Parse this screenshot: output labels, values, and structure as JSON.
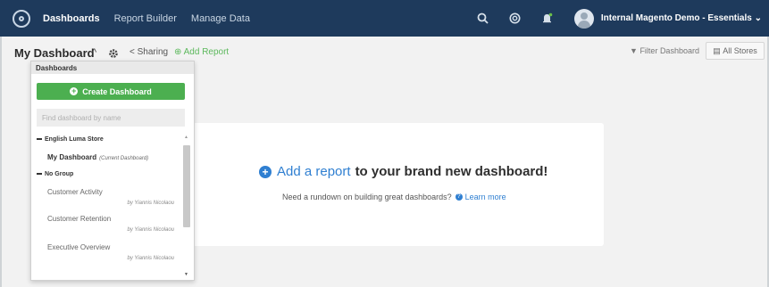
{
  "topnav": {
    "items": [
      {
        "label": "Dashboards"
      },
      {
        "label": "Report Builder"
      },
      {
        "label": "Manage Data"
      }
    ],
    "account": "Internal Magento Demo - Essentials",
    "icons": [
      "search-icon",
      "globe-icon",
      "bell-icon"
    ]
  },
  "toolbar": {
    "dashboard_name": "My Dashboard",
    "sharing": "Sharing",
    "add_report": "Add Report",
    "filter": "Filter Dashboard",
    "all_stores": "All Stores"
  },
  "panel": {
    "header": "Dashboards",
    "create_button": "Create Dashboard",
    "search_placeholder": "Find dashboard by name",
    "groups": [
      {
        "name": "English Luma Store"
      },
      {
        "name": "No Group"
      }
    ],
    "items": [
      {
        "name": "My Dashboard",
        "note": "(Current Dashboard)"
      },
      {
        "name": "Customer Activity",
        "by": "by Yiannis Nicolaou"
      },
      {
        "name": "Customer Retention",
        "by": "by Yiannis Nicolaou"
      },
      {
        "name": "Executive Overview",
        "by": "by Yiannis Nicolaou"
      }
    ]
  },
  "empty_state": {
    "link": "Add a report",
    "headline_rest": "to your brand new dashboard!",
    "sub": "Need a rundown on building great dashboards?",
    "learn_more": "Learn more"
  },
  "colors": {
    "nav_bg": "#1e3a5c",
    "accent_green": "#4caf50",
    "link_blue": "#2f7fd1"
  }
}
